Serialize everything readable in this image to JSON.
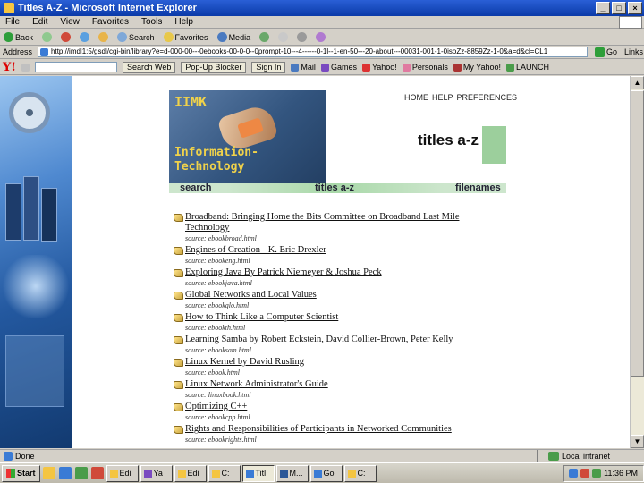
{
  "window": {
    "title": "Titles A-Z - Microsoft Internet Explorer",
    "controls": [
      "_",
      "□",
      "×"
    ]
  },
  "menu": [
    "File",
    "Edit",
    "View",
    "Favorites",
    "Tools",
    "Help"
  ],
  "toolbar": {
    "back": "Back",
    "search": "Search",
    "favorites": "Favorites",
    "media": "Media"
  },
  "address": {
    "label": "Address",
    "url": "http://imdl1:5/gsdl/cgi-bin/library?e=d-000-00---0ebooks-00-0-0--0prompt-10---4------0-1l--1-en-50---20-about---00031-001-1-0isoZz-8859Zz-1-0&a=d&cl=CL1",
    "go": "Go",
    "links": "Links"
  },
  "yahoo": {
    "logo": "Y!",
    "search_button": "Search Web",
    "popup_blocker": "Pop-Up Blocker",
    "sign_in": "Sign In",
    "mail": "Mail",
    "games": "Games",
    "yahoo": "Yahoo!",
    "personals": "Personals",
    "my_yahoo": "My Yahoo!",
    "launch": "LAUNCH"
  },
  "site": {
    "banner_iimk": "IIMK",
    "banner_info": "Information-",
    "banner_tech": "Technology",
    "top_nav": [
      "HOME",
      "HELP",
      "PREFERENCES"
    ],
    "heading": "titles a-z",
    "tabs": {
      "search": "search",
      "titles": "titles a-z",
      "filenames": "filenames"
    }
  },
  "titles": [
    {
      "title": "Broadband: Bringing Home the Bits Committee on Broadband Last Mile Technology",
      "source": "source: ebookbroad.html"
    },
    {
      "title": "Engines of Creation - K. Eric Drexler",
      "source": "source: ebookeng.html"
    },
    {
      "title": "Exploring Java By Patrick Niemeyer & Joshua Peck",
      "source": "source: ebookjava.html"
    },
    {
      "title": "Global Networks and Local Values",
      "source": "source: ebookglo.html"
    },
    {
      "title": "How to Think Like a Computer Scientist",
      "source": "source: ebookth.html"
    },
    {
      "title": "Learning Samba by Robert Eckstein, David Collier-Brown, Peter Kelly",
      "source": "source: ebooksam.html"
    },
    {
      "title": "Linux Kernel by David Rusling",
      "source": "source: ebook.html"
    },
    {
      "title": "Linux Network Administrator's Guide",
      "source": "source: linuxbook.html"
    },
    {
      "title": "Optimizing C++",
      "source": "source: ebookcpp.html"
    },
    {
      "title": "Rights and Responsibilities of Participants in Networked Communities",
      "source": "source: ebookrights.html"
    }
  ],
  "status": {
    "text": "Done",
    "zone": "Local intranet"
  },
  "taskbar": {
    "start": "Start",
    "tasks": [
      "Edi",
      "Ya",
      "Edi",
      "C:",
      "Titl",
      "M...",
      "Go",
      "C:"
    ],
    "time": "11:36 PM"
  },
  "colors": {
    "title_bar": "#0a3aa8",
    "banner_text": "#f0d24a",
    "nav_green": "#cde6cd",
    "heading_accent": "#9ccf9c"
  }
}
